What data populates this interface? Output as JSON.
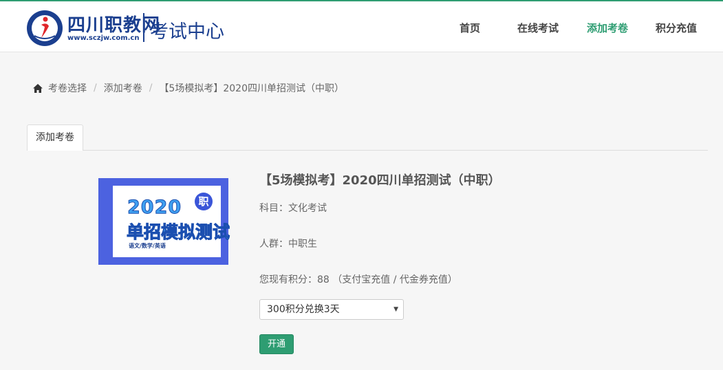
{
  "header": {
    "logo_small_text": "四川职教网",
    "brand": "四川职教网",
    "brand_url": "www.sczjw.com.cn",
    "subtitle": "考试中心",
    "nav": [
      "首页",
      "在线考试",
      "添加考卷",
      "积分充值"
    ],
    "active_nav": "添加考卷",
    "accent_color": "#2e9d72",
    "brand_color": "#1b3f8f"
  },
  "breadcrumb": {
    "icon": "home-icon",
    "items": [
      "考卷选择",
      "添加考卷",
      "【5场模拟考】2020四川单招测试（中职）"
    ]
  },
  "tab": {
    "label": "添加考卷"
  },
  "cover": {
    "year": "2020",
    "badge": "职",
    "title": "单招模拟测试",
    "subjects": "语文/数学/英语",
    "frame_color": "#4c62e0"
  },
  "exam": {
    "title": "【5场模拟考】2020四川单招测试（中职）",
    "subject_label": "科目：",
    "subject": "文化考试",
    "audience_label": "人群：",
    "audience": "中职生",
    "points_label": "您现有积分：",
    "points": "88",
    "recharge_prefix": "（",
    "recharge_alipay": "支付宝充值",
    "recharge_sep": " / ",
    "recharge_voucher": "代金券充值",
    "recharge_suffix": "）",
    "plan_selected": "300积分兑换3天",
    "open_button": "开通"
  }
}
